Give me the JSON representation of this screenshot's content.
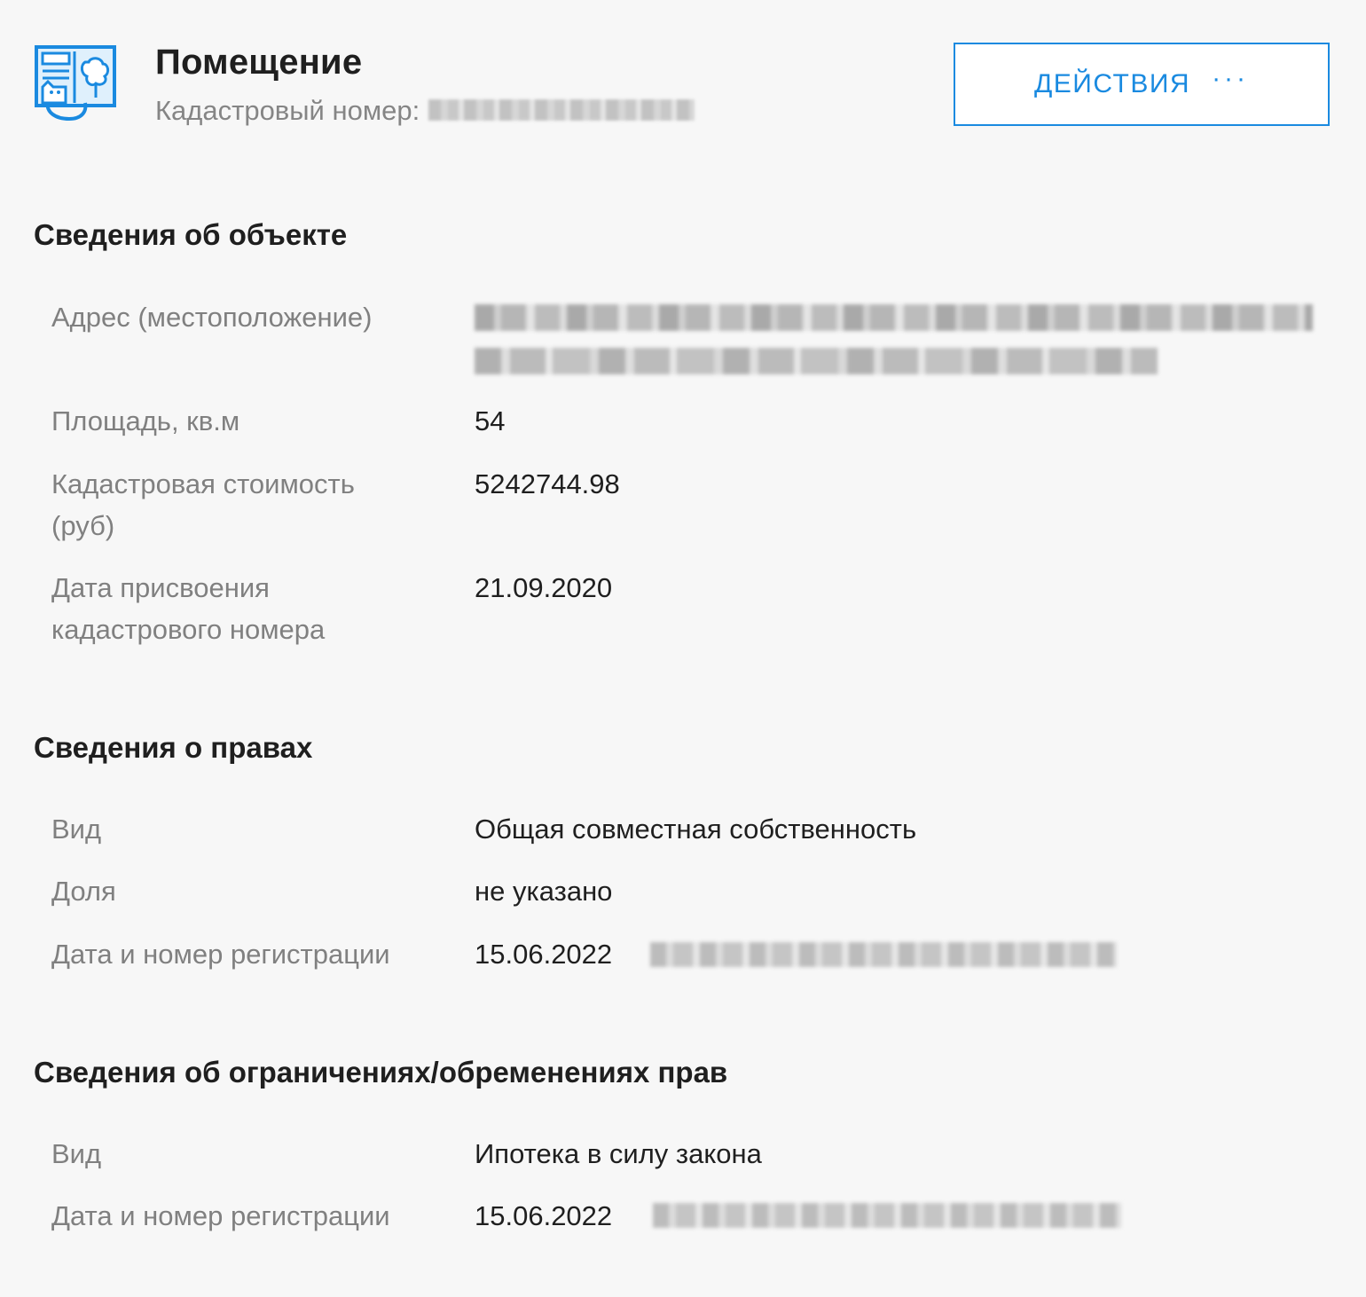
{
  "header": {
    "title": "Помещение",
    "cadastral_label": "Кадастровый номер:",
    "actions_label": "ДЕЙСТВИЯ",
    "actions_dots": "···"
  },
  "colors": {
    "accent": "#1a8ae0",
    "background": "#f7f7f7",
    "label": "#808080",
    "value": "#1f1f1f"
  },
  "icons": {
    "object": "room-icon",
    "more": "more-dots-icon"
  },
  "sections": {
    "object": {
      "title": "Сведения об объекте",
      "rows": [
        {
          "label": "Адрес (местоположение)",
          "value": ""
        },
        {
          "label": "Площадь, кв.м",
          "value": "54"
        },
        {
          "label": "Кадастровая стоимость (руб)",
          "value": "5242744.98"
        },
        {
          "label": "Дата присвоения кадастрового номера",
          "value": "21.09.2020"
        }
      ]
    },
    "rights": {
      "title": "Сведения о правах",
      "rows": [
        {
          "label": "Вид",
          "value": "Общая совместная собственность"
        },
        {
          "label": "Доля",
          "value": "не указано"
        },
        {
          "label": "Дата и номер регистрации",
          "value": "15.06.2022"
        }
      ]
    },
    "encumbrances": {
      "title": "Сведения об ограничениях/обременениях прав",
      "rows": [
        {
          "label": "Вид",
          "value": "Ипотека в силу закона"
        },
        {
          "label": "Дата и номер регистрации",
          "value": "15.06.2022"
        }
      ]
    }
  }
}
